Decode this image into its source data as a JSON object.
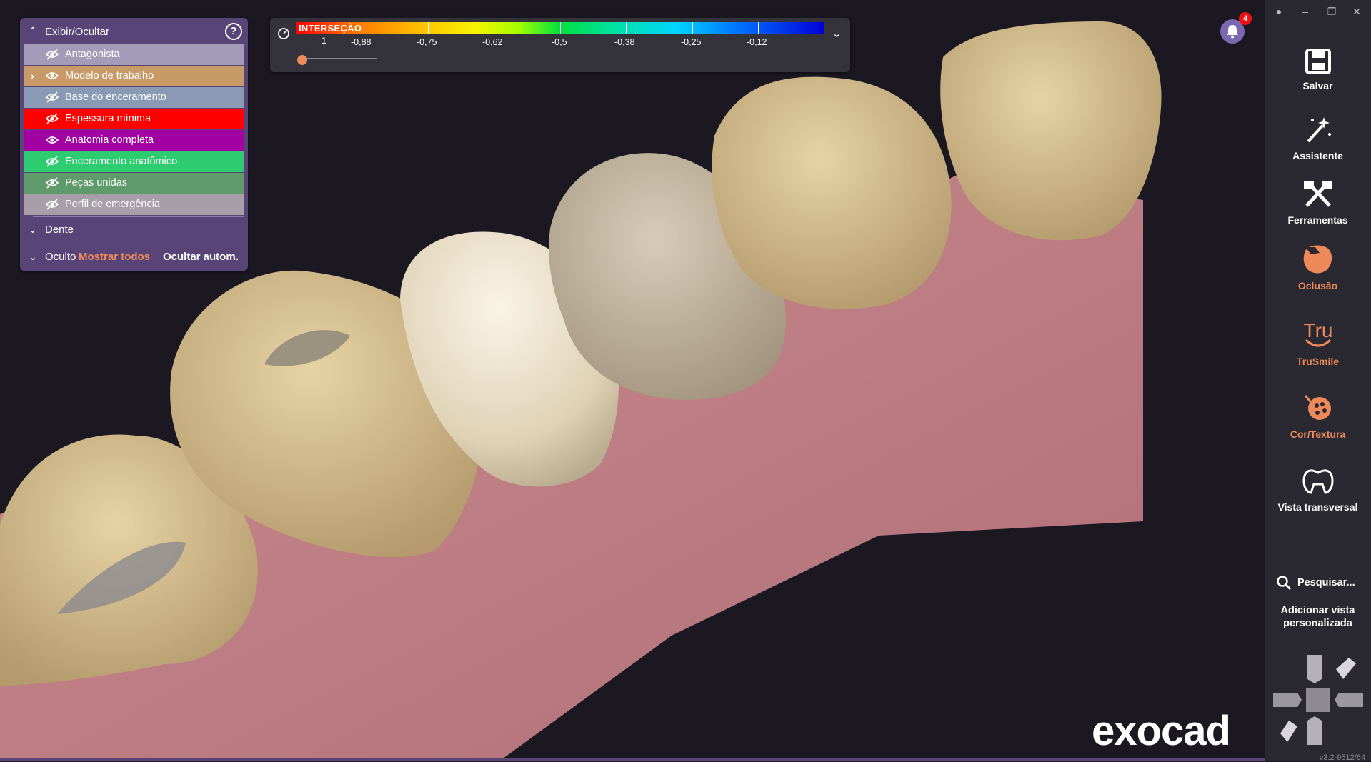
{
  "layers_panel": {
    "title": "Exibir/Ocultar",
    "help": "?",
    "layers": [
      {
        "label": "Antagonista",
        "visible": false,
        "expandable": false,
        "color": "#a39bb8"
      },
      {
        "label": "Modelo de trabalho",
        "visible": true,
        "expandable": true,
        "color": "#c89a68"
      },
      {
        "label": "Base do enceramento",
        "visible": false,
        "expandable": false,
        "color": "#8a9ab4"
      },
      {
        "label": "Espessura mínima",
        "visible": false,
        "expandable": false,
        "color": "#ff0000"
      },
      {
        "label": "Anatomia completa",
        "visible": true,
        "expandable": false,
        "color": "#a300a3"
      },
      {
        "label": "Enceramento anatômico",
        "visible": false,
        "expandable": false,
        "color": "#2ecc71"
      },
      {
        "label": "Peças unidas",
        "visible": false,
        "expandable": false,
        "color": "#5f9a6a"
      },
      {
        "label": "Perfil de emergência",
        "visible": false,
        "expandable": false,
        "color": "#a89ea8"
      }
    ],
    "section_tooth": "Dente",
    "section_hidden": "Oculto",
    "show_all": "Mostrar todos",
    "auto_hide": "Ocultar autom."
  },
  "color_scale": {
    "title": "INTERSEÇÃO",
    "labels": [
      "-1",
      "-0,88",
      "-0,75",
      "-0,62",
      "-0,5",
      "-0,38",
      "-0,25",
      "-0,12"
    ],
    "slider_value": 0
  },
  "notifications": {
    "count": "4"
  },
  "sidebar": {
    "buttons": [
      {
        "label": "Salvar",
        "icon": "save-icon",
        "accent": false
      },
      {
        "label": "Assistente",
        "icon": "magic-wand-icon",
        "accent": false
      },
      {
        "label": "Ferramentas",
        "icon": "tools-icon",
        "accent": false
      },
      {
        "label": "Oclusão",
        "icon": "occlusion-icon",
        "accent": true
      },
      {
        "label": "TruSmile",
        "icon": "trusmile-icon",
        "accent": true
      },
      {
        "label": "Cor/Textura",
        "icon": "palette-icon",
        "accent": true
      },
      {
        "label": "Vista transversal",
        "icon": "cross-section-icon",
        "accent": false
      }
    ],
    "search": "Pesquisar...",
    "custom_view": "Adicionar vista personalizada",
    "version": "v3.2-9512/64"
  },
  "brand": "exocad",
  "colors": {
    "accent": "#ee8a5a",
    "panel": "#584476",
    "background": "#1b1822"
  }
}
